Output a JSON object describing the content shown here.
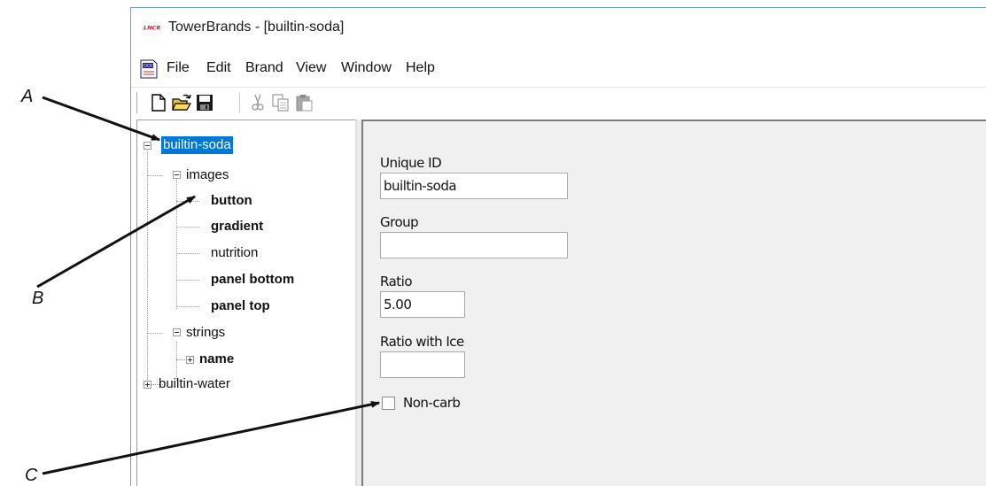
{
  "window": {
    "title": "TowerBrands - [builtin-soda]",
    "logo_text": "LANCER"
  },
  "menu": {
    "items": [
      "File",
      "Edit",
      "Brand",
      "View",
      "Window",
      "Help"
    ]
  },
  "toolbar": {
    "buttons": [
      "new-icon",
      "open-icon",
      "save-icon",
      "cut-icon",
      "copy-icon",
      "paste-icon"
    ]
  },
  "tree": {
    "root1": "builtin-soda",
    "images": "images",
    "image_items": [
      "button",
      "gradient",
      "nutrition",
      "panel bottom",
      "panel top"
    ],
    "strings": "strings",
    "string_items": [
      "name"
    ],
    "root2": "builtin-water"
  },
  "form": {
    "unique_id_label": "Unique ID",
    "unique_id_value": "builtin-soda",
    "group_label": "Group",
    "group_value": "",
    "ratio_label": "Ratio",
    "ratio_value": "5.00",
    "ratio_ice_label": "Ratio with Ice",
    "ratio_ice_value": "",
    "noncarb_label": "Non-carb",
    "noncarb_checked": false
  },
  "callouts": {
    "a": "A",
    "b": "B",
    "c": "C"
  },
  "colors": {
    "selection": "#0078d7",
    "window_border": "#6f9fd0",
    "panel_bg": "#f0f0f0"
  }
}
